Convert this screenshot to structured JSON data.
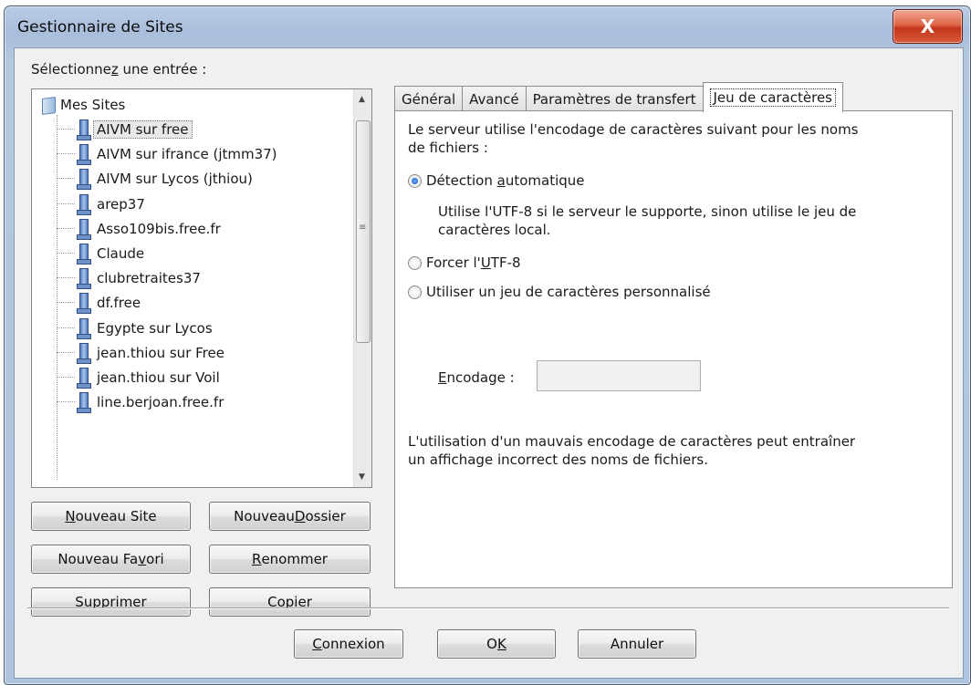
{
  "window": {
    "title": "Gestionnaire de Sites",
    "close_glyph": "X"
  },
  "left": {
    "select_label_pre": "Sélectionne",
    "select_label_ul": "z",
    "select_label_post": " une entrée :",
    "tree": {
      "root": "Mes Sites",
      "items": [
        "AIVM sur free",
        "AIVM sur ifrance (jtmm37)",
        "AIVM sur Lycos (jthiou)",
        "arep37",
        "Asso109bis.free.fr",
        "Claude",
        "clubretraites37",
        "df.free",
        "Egypte sur Lycos",
        "jean.thiou sur Free",
        "jean.thiou sur Voil",
        "line.berjoan.free.fr"
      ],
      "selected_index": 0
    },
    "buttons": {
      "new_site": {
        "pre": "",
        "ul": "N",
        "post": "ouveau Site"
      },
      "new_folder": {
        "pre": "Nouveau ",
        "ul": "D",
        "post": "ossier"
      },
      "new_bookmark": {
        "pre": "Nouveau Fa",
        "ul": "v",
        "post": "ori"
      },
      "rename": {
        "pre": "",
        "ul": "R",
        "post": "enommer"
      },
      "delete": {
        "pre": "",
        "ul": "S",
        "post": "upprimer"
      },
      "copy": {
        "pre": "Copi",
        "ul": "e",
        "post": "r"
      }
    }
  },
  "tabs": [
    {
      "label": "Général"
    },
    {
      "label": "Avancé"
    },
    {
      "label": "Paramètres de transfert"
    },
    {
      "label": "Jeu de caractères"
    }
  ],
  "active_tab": 3,
  "charset": {
    "intro_line1": "Le serveur utilise l'encodage de caractères suivant pour les noms",
    "intro_line2": "de fichiers :",
    "auto": {
      "pre": "Détection ",
      "ul": "a",
      "post": "utomatique",
      "checked": true
    },
    "auto_help_line1": "Utilise l'UTF-8 si le serveur le supporte, sinon utilise le jeu de",
    "auto_help_line2": "caractères local.",
    "force_utf8": {
      "pre": "Forcer l'",
      "ul": "U",
      "post": "TF-8",
      "checked": false
    },
    "custom": {
      "pre": "Utiliser un ",
      "ul": "j",
      "post": "eu de caractères personnalisé",
      "checked": false
    },
    "encoding_label": {
      "pre": "",
      "ul": "E",
      "post": "ncodage :"
    },
    "encoding_value": "",
    "warning_line1": "L'utilisation d'un mauvais encodage de caractères peut entraîner",
    "warning_line2": "un affichage incorrect des noms de fichiers."
  },
  "footer": {
    "connect": {
      "pre": "",
      "ul": "C",
      "post": "onnexion"
    },
    "ok": {
      "pre": "O",
      "ul": "K",
      "post": ""
    },
    "cancel": {
      "label": "Annuler"
    }
  },
  "colors": {
    "accent": "#1d62c8",
    "close_button": "#c4351b",
    "frame": "#aec3de"
  }
}
